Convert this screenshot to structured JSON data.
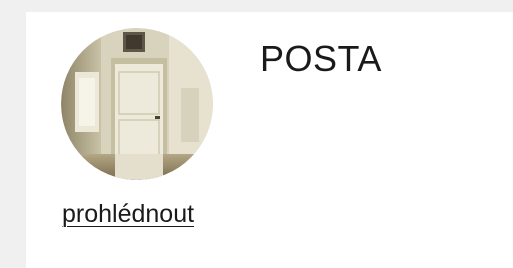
{
  "item": {
    "title": "POSTA",
    "link_label": "prohlédnout",
    "thumbnail": "door-room-photo"
  }
}
